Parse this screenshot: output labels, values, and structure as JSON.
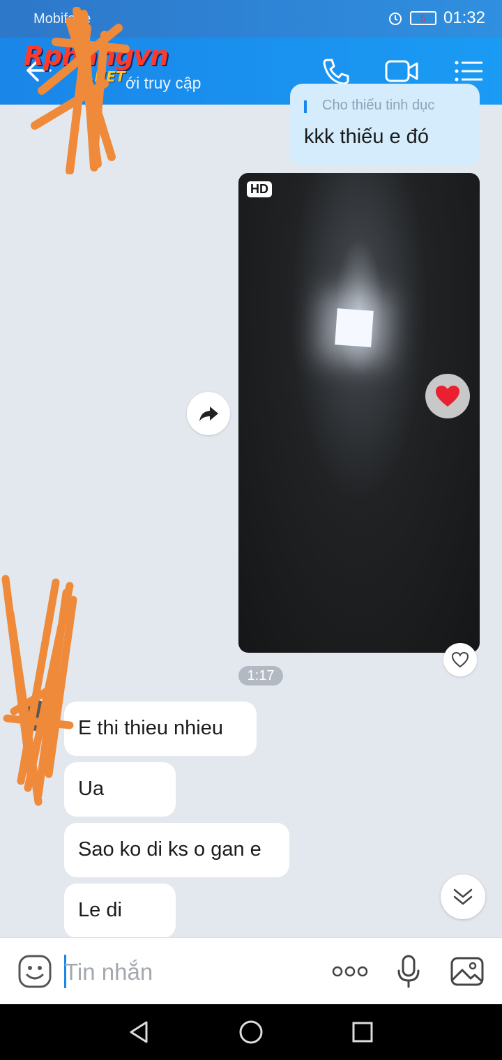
{
  "status_bar": {
    "carrier": "Mobifone",
    "battery": "5",
    "time": "01:32"
  },
  "header": {
    "subtitle": "ới truy cập",
    "watermark": "Rphangvn",
    "watermark_suffix": ".NET"
  },
  "messages": {
    "outgoing_reply_quote": "Cho thiếu tinh dục",
    "outgoing_text": "kkk thiếu e đó",
    "video": {
      "badge": "HD",
      "duration": "1:17"
    },
    "incoming": [
      "E thi thieu nhieu",
      "Ua",
      "Sao ko di ks o gan e",
      "Le di"
    ]
  },
  "input": {
    "placeholder": "Tin nhắn"
  },
  "colors": {
    "header": "#1a9bf4",
    "chat_bg": "#e3e8ef",
    "outgoing_bubble": "#d4ecfb",
    "incoming_bubble": "#ffffff",
    "accent": "#1a86e8"
  }
}
